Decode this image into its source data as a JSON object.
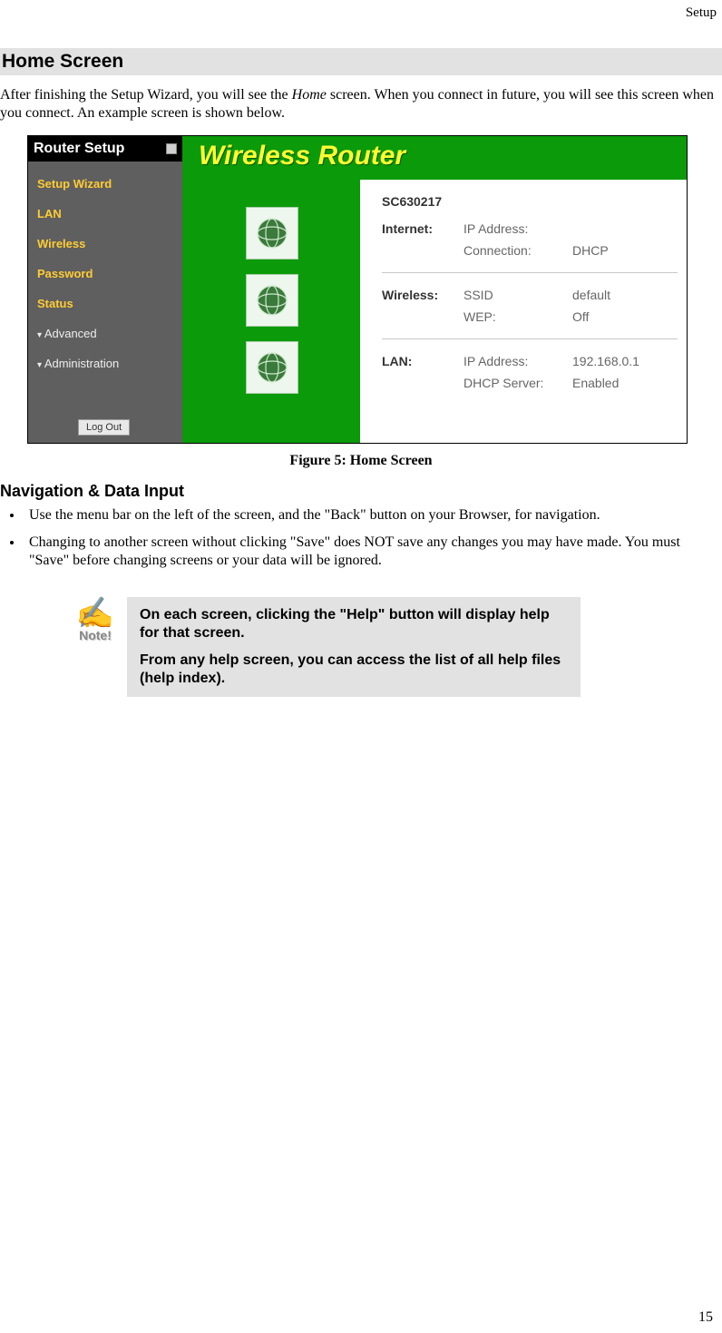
{
  "header": {
    "breadcrumb": "Setup"
  },
  "section_title": "Home Screen",
  "intro_before": "After finishing the Setup Wizard, you will see the ",
  "intro_italic": "Home",
  "intro_after": " screen. When you connect in future, you will see this screen when you connect. An example screen is shown below.",
  "figure": {
    "sidebar_title": "Router Setup",
    "menu": [
      "Setup Wizard",
      "LAN",
      "Wireless",
      "Password",
      "Status"
    ],
    "menu_heads": [
      "Advanced",
      "Administration"
    ],
    "logout": "Log Out",
    "banner": "Wireless Router",
    "device": "SC630217",
    "sections": [
      {
        "label": "Internet:",
        "rows": [
          {
            "key": "IP Address:",
            "val": ""
          },
          {
            "key": "Connection:",
            "val": "DHCP"
          }
        ]
      },
      {
        "label": "Wireless:",
        "rows": [
          {
            "key": "SSID",
            "val": "default"
          },
          {
            "key": "WEP:",
            "val": "Off"
          }
        ]
      },
      {
        "label": "LAN:",
        "rows": [
          {
            "key": "IP Address:",
            "val": "192.168.0.1"
          },
          {
            "key": "DHCP Server:",
            "val": "Enabled"
          }
        ]
      }
    ]
  },
  "caption": "Figure 5: Home Screen",
  "subsection": "Navigation & Data Input",
  "bullets": [
    "Use the menu bar on the left of the screen, and the \"Back\" button on your Browser, for navigation.",
    "Changing to another screen without clicking \"Save\" does NOT save any changes you may have made. You must \"Save\" before changing screens or your data will be ignored."
  ],
  "note": {
    "icon_label": "Note!",
    "p1": "On each screen, clicking the \"Help\" button will display help for that screen.",
    "p2": "From any help screen, you can access the list of all help files (help index)."
  },
  "page_number": "15"
}
